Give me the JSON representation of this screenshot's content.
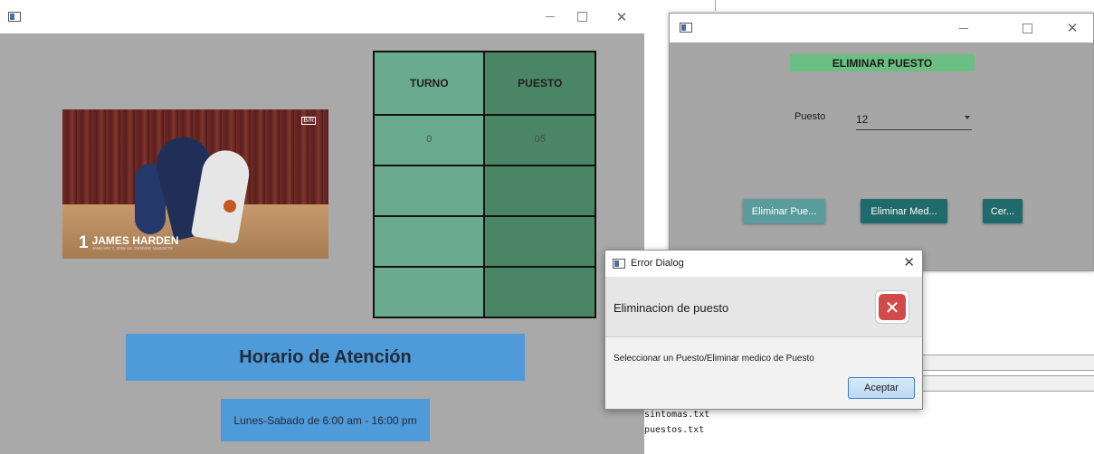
{
  "main_window": {
    "video": {
      "player_number": "1",
      "player_name": "JAMES HARDEN",
      "caption_sub": "JANUARY 7, 2019 VS. DENVER NUGGETS",
      "badge": "B/R"
    },
    "table": {
      "headers": [
        "TURNO",
        "PUESTO"
      ],
      "rows": [
        [
          "0",
          "05"
        ],
        [
          "",
          ""
        ],
        [
          "",
          ""
        ],
        [
          "",
          ""
        ]
      ]
    },
    "schedule_title": "Horario de Atención",
    "schedule_hours": "Lunes-Sabado de 6:00 am - 16:00 pm"
  },
  "delete_window": {
    "title": "ELIMINAR PUESTO",
    "puesto_label": "Puesto",
    "puesto_value": "12",
    "buttons": {
      "eliminar_puesto": "Eliminar Pue...",
      "eliminar_medico": "Eliminar Med...",
      "cerrar": "Cer..."
    }
  },
  "error_dialog": {
    "title": "Error Dialog",
    "heading": "Eliminacion de puesto",
    "message": "Seleccionar un Puesto/Eliminar medico de Puesto",
    "accept_label": "Aceptar"
  },
  "console": {
    "files": [
      "sintomas.txt",
      "puestos.txt"
    ]
  },
  "colors": {
    "window_bg": "#a9a9a9",
    "turno_col": "#6aab90",
    "puesto_col": "#4a8565",
    "schedule_bg": "#4f9ad8",
    "delete_title_bg": "#6bbf82",
    "button_teal": "#1f6a6a",
    "error_red": "#d24b4b"
  }
}
